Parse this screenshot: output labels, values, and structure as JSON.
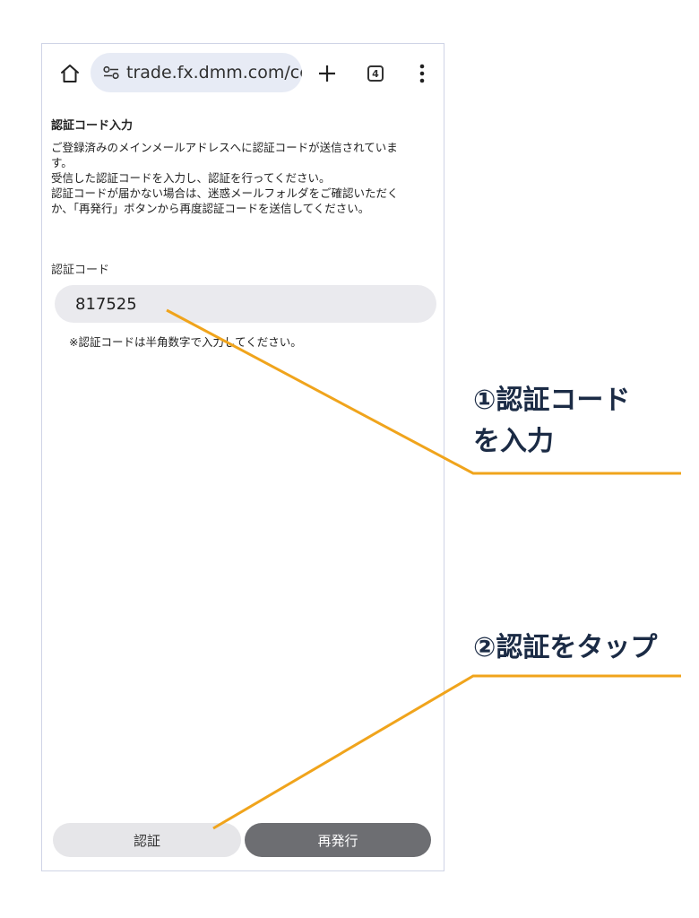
{
  "browser": {
    "url": "trade.fx.dmm.com/co",
    "tab_count": "4",
    "icons": {
      "home": "home-icon",
      "site_settings": "site-settings-icon",
      "new_tab": "plus-icon",
      "tabs": "tab-switcher-icon",
      "menu": "more-vert-icon"
    }
  },
  "page": {
    "title": "認証コード入力",
    "description_lines": [
      "ご登録済みのメインメールアドレスへに認証コードが送信されていま",
      "す。",
      "受信した認証コードを入力し、認証を行ってください。",
      "認証コードが届かない場合は、迷惑メールフォルダをご確認いただく",
      "か、「再発行」ボタンから再度認証コードを送信してください。"
    ],
    "code_label": "認証コード",
    "code_value": "817525",
    "code_hint": "※認証コードは半角数字で入力してください。",
    "verify_label": "認証",
    "resend_label": "再発行"
  },
  "annotations": {
    "step1_line1": "①認証コード",
    "step1_line2": "を入力",
    "step2": "②認証をタップ",
    "line_color": "#f0a41c"
  },
  "colors": {
    "text_dark": "#222222",
    "input_bg": "#eaeaee",
    "resend_bg": "#6d6e72",
    "address_bar_bg": "#e7ebf5",
    "callout_text": "#1b2b45"
  }
}
